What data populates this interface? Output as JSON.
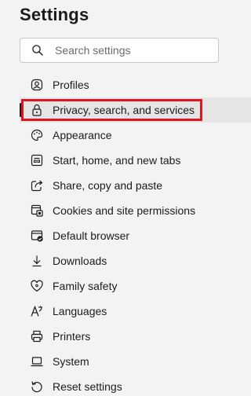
{
  "header": {
    "title": "Settings"
  },
  "search": {
    "placeholder": "Search settings",
    "icon": "search-icon"
  },
  "sidebar": {
    "items": [
      {
        "label": "Profiles",
        "icon": "profile-icon"
      },
      {
        "label": "Privacy, search, and services",
        "icon": "lock-icon",
        "selected": true,
        "highlighted": true
      },
      {
        "label": "Appearance",
        "icon": "palette-icon"
      },
      {
        "label": "Start, home, and new tabs",
        "icon": "home-icon"
      },
      {
        "label": "Share, copy and paste",
        "icon": "share-icon"
      },
      {
        "label": "Cookies and site permissions",
        "icon": "cookies-icon"
      },
      {
        "label": "Default browser",
        "icon": "browser-icon"
      },
      {
        "label": "Downloads",
        "icon": "download-icon"
      },
      {
        "label": "Family safety",
        "icon": "family-icon"
      },
      {
        "label": "Languages",
        "icon": "languages-icon"
      },
      {
        "label": "Printers",
        "icon": "printer-icon"
      },
      {
        "label": "System",
        "icon": "laptop-icon"
      },
      {
        "label": "Reset settings",
        "icon": "reset-icon"
      }
    ]
  },
  "colors": {
    "highlight_border": "#e0161e",
    "selected_bg": "#e5e5e5",
    "background": "#f3f3f3"
  }
}
